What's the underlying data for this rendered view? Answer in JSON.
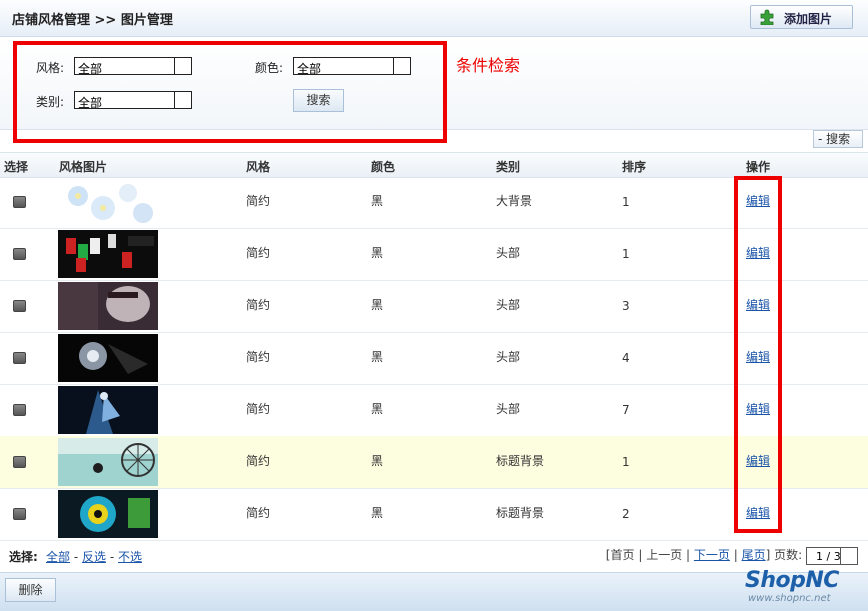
{
  "header": {
    "title": "店铺风格管理  >> 图片管理",
    "add_button_label": "添加图片"
  },
  "filters": {
    "style_label": "风格:",
    "style_value": "全部",
    "color_label": "颜色:",
    "color_value": "全部",
    "category_label": "类别:",
    "category_value": "全部",
    "search_button": "搜索",
    "annotation": "条件检索"
  },
  "toggle_search_label": "搜索",
  "table": {
    "columns": [
      "选择",
      "风格图片",
      "风格",
      "颜色",
      "类别",
      "排序",
      "操作"
    ],
    "rows": [
      {
        "style": "简约",
        "color": "黑",
        "category": "大背景",
        "order": "1",
        "action": "编辑",
        "thumb": "flowers-light-blue"
      },
      {
        "style": "简约",
        "color": "黑",
        "category": "头部",
        "order": "1",
        "action": "编辑",
        "thumb": "dark-cards-red"
      },
      {
        "style": "简约",
        "color": "黑",
        "category": "头部",
        "order": "3",
        "action": "编辑",
        "thumb": "dark-face"
      },
      {
        "style": "简约",
        "color": "黑",
        "category": "头部",
        "order": "4",
        "action": "编辑",
        "thumb": "dark-light-burst"
      },
      {
        "style": "简约",
        "color": "黑",
        "category": "头部",
        "order": "7",
        "action": "编辑",
        "thumb": "dark-blue-figure"
      },
      {
        "style": "简约",
        "color": "黑",
        "category": "标题背景",
        "order": "1",
        "action": "编辑",
        "thumb": "teal-umbrella"
      },
      {
        "style": "简约",
        "color": "黑",
        "category": "标题背景",
        "order": "2",
        "action": "编辑",
        "thumb": "cyan-yellow-pattern"
      }
    ]
  },
  "footer": {
    "select_label": "选择:",
    "select_all": "全部",
    "invert": "反选",
    "none": "不选",
    "first": "首页",
    "prev": "上一页",
    "next": "下一页",
    "last": "尾页",
    "pages_label": "页数:",
    "pages_value": "1 / 3"
  },
  "bottom": {
    "delete_button": "删除",
    "logo_text": "ShopNC",
    "logo_url": "www.shopnc.net"
  },
  "colors": {
    "annotation_red": "#ee0000",
    "link_blue": "#1a55a8",
    "highlight_row": "#fdfde0"
  }
}
